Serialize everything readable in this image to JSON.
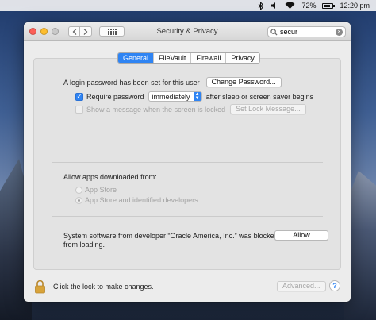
{
  "menubar": {
    "battery": "72%",
    "clock": "12:20 pm"
  },
  "window": {
    "title": "Security & Privacy",
    "search": {
      "value": "secur",
      "placeholder": "Search"
    }
  },
  "tabs": [
    {
      "label": "General",
      "active": true
    },
    {
      "label": "FileVault",
      "active": false
    },
    {
      "label": "Firewall",
      "active": false
    },
    {
      "label": "Privacy",
      "active": false
    }
  ],
  "general": {
    "login_text": "A login password has been set for this user",
    "change_password_btn": "Change Password...",
    "require_password_label": "Require password",
    "require_password_checked": true,
    "require_password_value": "immediately",
    "require_password_suffix": "after sleep or screen saver begins",
    "show_message_label": "Show a message when the screen is locked",
    "show_message_checked": false,
    "set_lock_message_btn": "Set Lock Message..."
  },
  "allow_apps": {
    "heading": "Allow apps downloaded from:",
    "options": [
      {
        "label": "App Store",
        "selected": false
      },
      {
        "label": "App Store and identified developers",
        "selected": true
      }
    ]
  },
  "blocked": {
    "text_line1": "System software from developer “Oracle America, Inc.” was blocked",
    "text_line2": "from loading.",
    "allow_btn": "Allow"
  },
  "footer": {
    "lock_text": "Click the lock to make changes.",
    "advanced_btn": "Advanced...",
    "help_label": "?"
  },
  "colors": {
    "accent": "#2f84f3",
    "close": "#fc5f57",
    "minimize": "#fdbd2e",
    "lock_gold": "#d8a33a"
  }
}
